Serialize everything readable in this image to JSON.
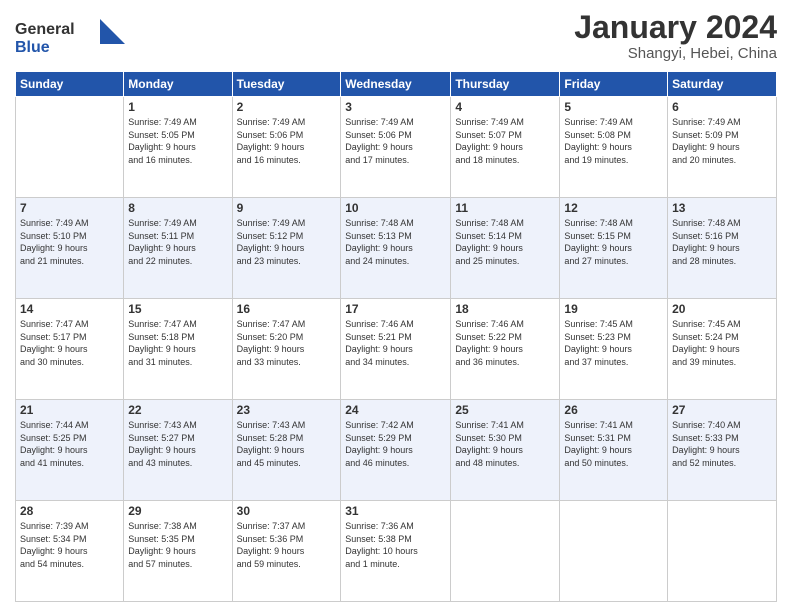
{
  "header": {
    "logo": {
      "line1": "General",
      "line2": "Blue"
    },
    "month": "January 2024",
    "location": "Shangyi, Hebei, China"
  },
  "weekdays": [
    "Sunday",
    "Monday",
    "Tuesday",
    "Wednesday",
    "Thursday",
    "Friday",
    "Saturday"
  ],
  "weeks": [
    [
      {
        "day": "",
        "info": ""
      },
      {
        "day": "1",
        "info": "Sunrise: 7:49 AM\nSunset: 5:05 PM\nDaylight: 9 hours\nand 16 minutes."
      },
      {
        "day": "2",
        "info": "Sunrise: 7:49 AM\nSunset: 5:06 PM\nDaylight: 9 hours\nand 16 minutes."
      },
      {
        "day": "3",
        "info": "Sunrise: 7:49 AM\nSunset: 5:06 PM\nDaylight: 9 hours\nand 17 minutes."
      },
      {
        "day": "4",
        "info": "Sunrise: 7:49 AM\nSunset: 5:07 PM\nDaylight: 9 hours\nand 18 minutes."
      },
      {
        "day": "5",
        "info": "Sunrise: 7:49 AM\nSunset: 5:08 PM\nDaylight: 9 hours\nand 19 minutes."
      },
      {
        "day": "6",
        "info": "Sunrise: 7:49 AM\nSunset: 5:09 PM\nDaylight: 9 hours\nand 20 minutes."
      }
    ],
    [
      {
        "day": "7",
        "info": "Sunrise: 7:49 AM\nSunset: 5:10 PM\nDaylight: 9 hours\nand 21 minutes."
      },
      {
        "day": "8",
        "info": "Sunrise: 7:49 AM\nSunset: 5:11 PM\nDaylight: 9 hours\nand 22 minutes."
      },
      {
        "day": "9",
        "info": "Sunrise: 7:49 AM\nSunset: 5:12 PM\nDaylight: 9 hours\nand 23 minutes."
      },
      {
        "day": "10",
        "info": "Sunrise: 7:48 AM\nSunset: 5:13 PM\nDaylight: 9 hours\nand 24 minutes."
      },
      {
        "day": "11",
        "info": "Sunrise: 7:48 AM\nSunset: 5:14 PM\nDaylight: 9 hours\nand 25 minutes."
      },
      {
        "day": "12",
        "info": "Sunrise: 7:48 AM\nSunset: 5:15 PM\nDaylight: 9 hours\nand 27 minutes."
      },
      {
        "day": "13",
        "info": "Sunrise: 7:48 AM\nSunset: 5:16 PM\nDaylight: 9 hours\nand 28 minutes."
      }
    ],
    [
      {
        "day": "14",
        "info": "Sunrise: 7:47 AM\nSunset: 5:17 PM\nDaylight: 9 hours\nand 30 minutes."
      },
      {
        "day": "15",
        "info": "Sunrise: 7:47 AM\nSunset: 5:18 PM\nDaylight: 9 hours\nand 31 minutes."
      },
      {
        "day": "16",
        "info": "Sunrise: 7:47 AM\nSunset: 5:20 PM\nDaylight: 9 hours\nand 33 minutes."
      },
      {
        "day": "17",
        "info": "Sunrise: 7:46 AM\nSunset: 5:21 PM\nDaylight: 9 hours\nand 34 minutes."
      },
      {
        "day": "18",
        "info": "Sunrise: 7:46 AM\nSunset: 5:22 PM\nDaylight: 9 hours\nand 36 minutes."
      },
      {
        "day": "19",
        "info": "Sunrise: 7:45 AM\nSunset: 5:23 PM\nDaylight: 9 hours\nand 37 minutes."
      },
      {
        "day": "20",
        "info": "Sunrise: 7:45 AM\nSunset: 5:24 PM\nDaylight: 9 hours\nand 39 minutes."
      }
    ],
    [
      {
        "day": "21",
        "info": "Sunrise: 7:44 AM\nSunset: 5:25 PM\nDaylight: 9 hours\nand 41 minutes."
      },
      {
        "day": "22",
        "info": "Sunrise: 7:43 AM\nSunset: 5:27 PM\nDaylight: 9 hours\nand 43 minutes."
      },
      {
        "day": "23",
        "info": "Sunrise: 7:43 AM\nSunset: 5:28 PM\nDaylight: 9 hours\nand 45 minutes."
      },
      {
        "day": "24",
        "info": "Sunrise: 7:42 AM\nSunset: 5:29 PM\nDaylight: 9 hours\nand 46 minutes."
      },
      {
        "day": "25",
        "info": "Sunrise: 7:41 AM\nSunset: 5:30 PM\nDaylight: 9 hours\nand 48 minutes."
      },
      {
        "day": "26",
        "info": "Sunrise: 7:41 AM\nSunset: 5:31 PM\nDaylight: 9 hours\nand 50 minutes."
      },
      {
        "day": "27",
        "info": "Sunrise: 7:40 AM\nSunset: 5:33 PM\nDaylight: 9 hours\nand 52 minutes."
      }
    ],
    [
      {
        "day": "28",
        "info": "Sunrise: 7:39 AM\nSunset: 5:34 PM\nDaylight: 9 hours\nand 54 minutes."
      },
      {
        "day": "29",
        "info": "Sunrise: 7:38 AM\nSunset: 5:35 PM\nDaylight: 9 hours\nand 57 minutes."
      },
      {
        "day": "30",
        "info": "Sunrise: 7:37 AM\nSunset: 5:36 PM\nDaylight: 9 hours\nand 59 minutes."
      },
      {
        "day": "31",
        "info": "Sunrise: 7:36 AM\nSunset: 5:38 PM\nDaylight: 10 hours\nand 1 minute."
      },
      {
        "day": "",
        "info": ""
      },
      {
        "day": "",
        "info": ""
      },
      {
        "day": "",
        "info": ""
      }
    ]
  ]
}
